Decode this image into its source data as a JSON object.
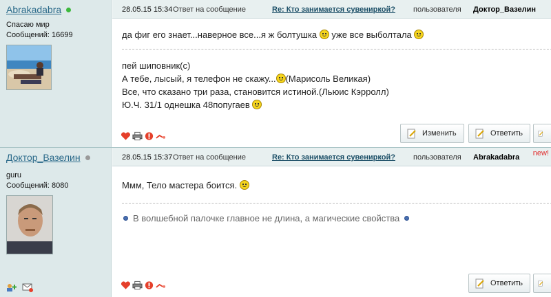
{
  "posts": [
    {
      "author": {
        "name": "Abrakadabra",
        "status_color": "#3cb93c",
        "title": "Спасаю мир",
        "count_label": "Сообщений: 16699",
        "avatar_icon": "beach-photo"
      },
      "header": {
        "date": "28.05.15 15:34",
        "reply_prefix": "Ответ на сообщение",
        "topic": "Re: Кто занимается сувениркой?",
        "middle": "пользователя",
        "user": "Доктор_Вазелин",
        "new_label": ""
      },
      "body": {
        "line1_a": "да фиг его знает...наверное все...я ж болтушка",
        "line1_b": "уже все выболтала",
        "sig1": "пей шиповник(с)",
        "sig2_a": "А тебе, лысый, я телефон не скажу...",
        "sig2_b": "(Марисоль Великая)",
        "sig3": "Все, что сказано три раза, становится истиной.(Льюис Кэрролл)",
        "sig4": "Ю.Ч. 31/1 однешка 48попугаев"
      },
      "buttons": {
        "edit": "Изменить",
        "reply": "Ответить"
      }
    },
    {
      "author": {
        "name": "Доктор_Вазелин",
        "status_color": "#9a9a9a",
        "title": "guru",
        "count_label": "Сообщений: 8080",
        "avatar_icon": "portrait-photo"
      },
      "header": {
        "date": "28.05.15 15:37",
        "reply_prefix": "Ответ на сообщение",
        "topic": "Re: Кто занимается сувениркой?",
        "middle": "пользователя",
        "user": "Abrakadabra",
        "new_label": "new!"
      },
      "body": {
        "line1": "Ммм, Тело мастера боится.",
        "sig": "В волшебной палочке главное не длина, а магические свойства"
      },
      "buttons": {
        "reply": "Ответить"
      }
    }
  ],
  "icons": [
    "heart-icon",
    "print-icon",
    "report-icon",
    "quote-icon",
    "add-contact-icon",
    "mail-icon"
  ],
  "colors": {
    "sidebar_bg": "#dde9ea",
    "header_bg": "#e8f0f0",
    "link": "#1c4f67",
    "new": "#e02b2b"
  }
}
